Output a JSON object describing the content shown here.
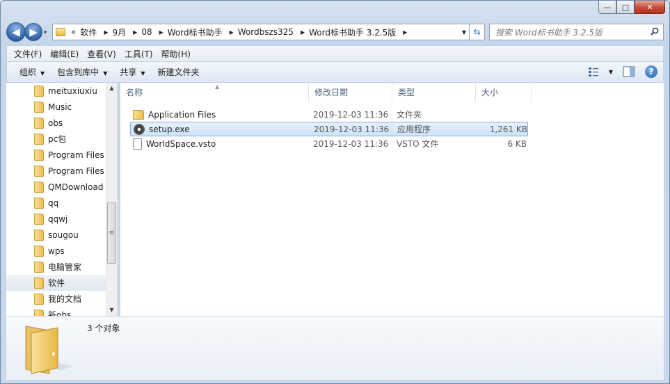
{
  "window": {
    "min_glyph": "—",
    "max_glyph": "□",
    "close_glyph": "✕"
  },
  "nav": {
    "back_glyph": "◀",
    "forward_glyph": "▶",
    "dropdown_glyph": "▾"
  },
  "address": {
    "overflow_glyph": "«",
    "crumbs": [
      "软件",
      "9月",
      "08",
      "Word标书助手",
      "Wordbszs325",
      "Word标书助手 3.2.5版"
    ]
  },
  "search": {
    "placeholder": "搜索 Word标书助手 3.2.5版"
  },
  "menu": [
    "文件(F)",
    "编辑(E)",
    "查看(V)",
    "工具(T)",
    "帮助(H)"
  ],
  "commands": [
    "组织",
    "包含到库中",
    "共享",
    "新建文件夹"
  ],
  "help_glyph": "?",
  "tree": [
    {
      "label": "meituxiuxiu",
      "selected": false
    },
    {
      "label": "Music",
      "selected": false
    },
    {
      "label": "obs",
      "selected": false
    },
    {
      "label": "pc包",
      "selected": false
    },
    {
      "label": "Program Files",
      "selected": false
    },
    {
      "label": "Program Files",
      "selected": false
    },
    {
      "label": "QMDownload",
      "selected": false
    },
    {
      "label": "qq",
      "selected": false
    },
    {
      "label": "qqwj",
      "selected": false
    },
    {
      "label": "sougou",
      "selected": false
    },
    {
      "label": "wps",
      "selected": false
    },
    {
      "label": "电脑管家",
      "selected": false
    },
    {
      "label": "软件",
      "selected": true
    },
    {
      "label": "我的文档",
      "selected": false
    },
    {
      "label": "新obs",
      "selected": false
    }
  ],
  "columns": {
    "name": "名称",
    "date": "修改日期",
    "type": "类型",
    "size": "大小"
  },
  "files": [
    {
      "name": "Application Files",
      "date": "2019-12-03 11:36",
      "type": "文件夹",
      "size": "",
      "icon": "folder-icon",
      "selected": false
    },
    {
      "name": "setup.exe",
      "date": "2019-12-03 11:36",
      "type": "应用程序",
      "size": "1,261 KB",
      "icon": "setup-app-icon",
      "selected": true
    },
    {
      "name": "WorldSpace.vsto",
      "date": "2019-12-03 11:36",
      "type": "VSTO 文件",
      "size": "6 KB",
      "icon": "document-icon",
      "selected": false
    }
  ],
  "status": {
    "item_count": "3 个对象"
  }
}
